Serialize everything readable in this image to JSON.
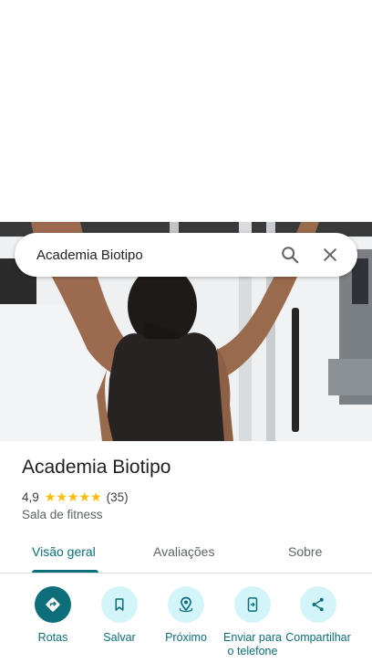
{
  "search": {
    "query": "Academia Biotipo",
    "search_icon": "search-icon",
    "close_icon": "close-icon"
  },
  "place": {
    "name": "Academia Biotipo",
    "rating": "4,9",
    "stars": 5,
    "review_count": "(35)",
    "category": "Sala de fitness"
  },
  "tabs": [
    {
      "label": "Visão geral",
      "active": true
    },
    {
      "label": "Avaliações",
      "active": false
    },
    {
      "label": "Sobre",
      "active": false
    }
  ],
  "actions": [
    {
      "label": "Rotas",
      "icon": "directions-icon"
    },
    {
      "label": "Salvar",
      "icon": "bookmark-icon"
    },
    {
      "label": "Próximo",
      "icon": "nearby-icon"
    },
    {
      "label": "Enviar para o telefone",
      "icon": "send-to-phone-icon"
    },
    {
      "label": "Compartilhar",
      "icon": "share-icon"
    }
  ],
  "colors": {
    "accent": "#0b6e79",
    "accent_light": "#d3f4f9",
    "star": "#fbbc04"
  }
}
